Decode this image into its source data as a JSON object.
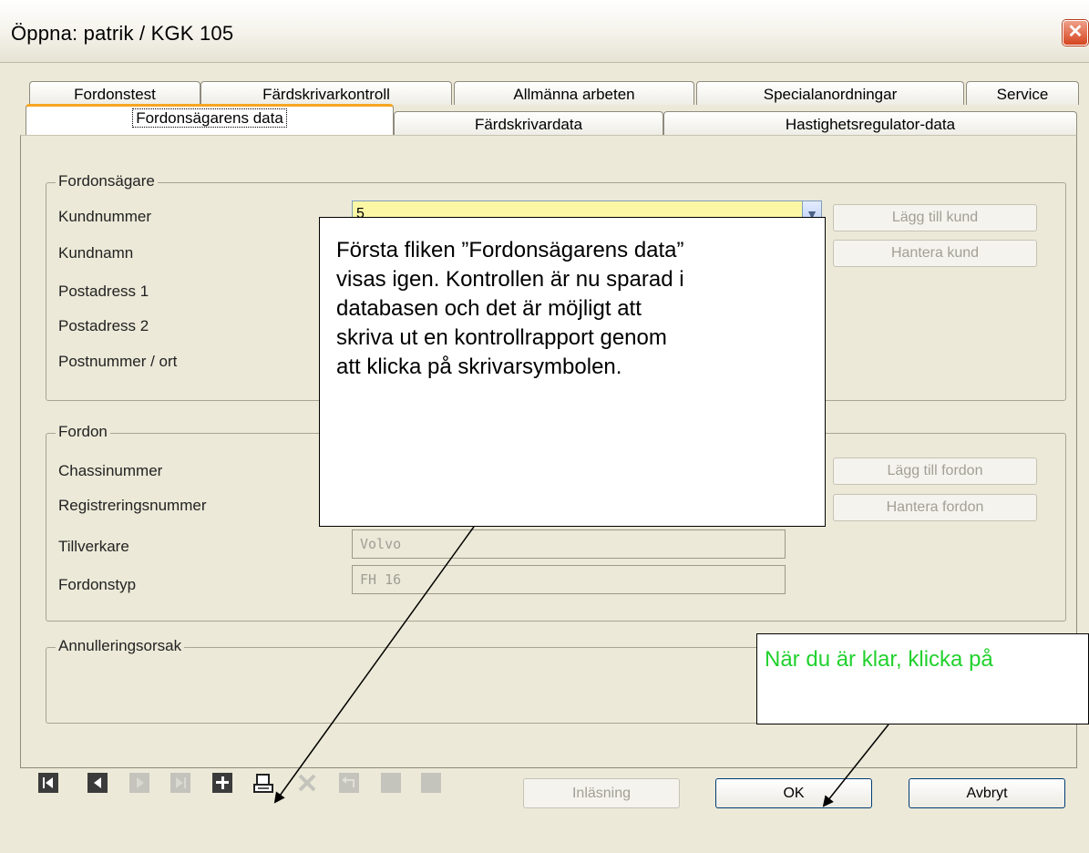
{
  "window": {
    "title": "Öppna: patrik / KGK 105",
    "close_glyph": "✕"
  },
  "tabs_back": [
    "Fordonstest",
    "Färdskrivarkontroll",
    "Allmänna arbeten",
    "Specialanordningar",
    "Service"
  ],
  "tabs_front": [
    "Fordonsägarens data",
    "Färdskrivardata",
    "Hastighetsregulator-data"
  ],
  "owner": {
    "legend": "Fordonsägare",
    "labels": [
      "Kundnummer",
      "Kundnamn",
      "Postadress 1",
      "Postadress 2",
      "Postnummer / ort"
    ],
    "kundnummer_value": "5",
    "add_button": "Lägg till kund",
    "manage_button": "Hantera kund"
  },
  "vehicle": {
    "legend": "Fordon",
    "labels": [
      "Chassinummer",
      "Registreringsnummer",
      "Tillverkare",
      "Fordonstyp"
    ],
    "tillverkare_value": "Volvo",
    "fordonstyp_value": "FH 16",
    "add_button": "Lägg till fordon",
    "manage_button": "Hantera fordon"
  },
  "cancel_section": {
    "legend": "Annulleringsorsak"
  },
  "footer": {
    "inlasning": "Inläsning",
    "ok": "OK",
    "cancel": "Avbryt"
  },
  "callouts": {
    "main": [
      "Första fliken ”Fordonsägarens data”",
      "visas igen. Kontrollen är nu sparad i",
      "databasen och det är möjligt att",
      "skriva ut en kontrollrapport genom",
      "att klicka på skrivarsymbolen."
    ],
    "ok_hint": "När du är klar, klicka på"
  },
  "colors": {
    "accent_tab": "#f5a623",
    "callout_green": "#22d12e",
    "combo_bg": "#fbf7a5"
  }
}
